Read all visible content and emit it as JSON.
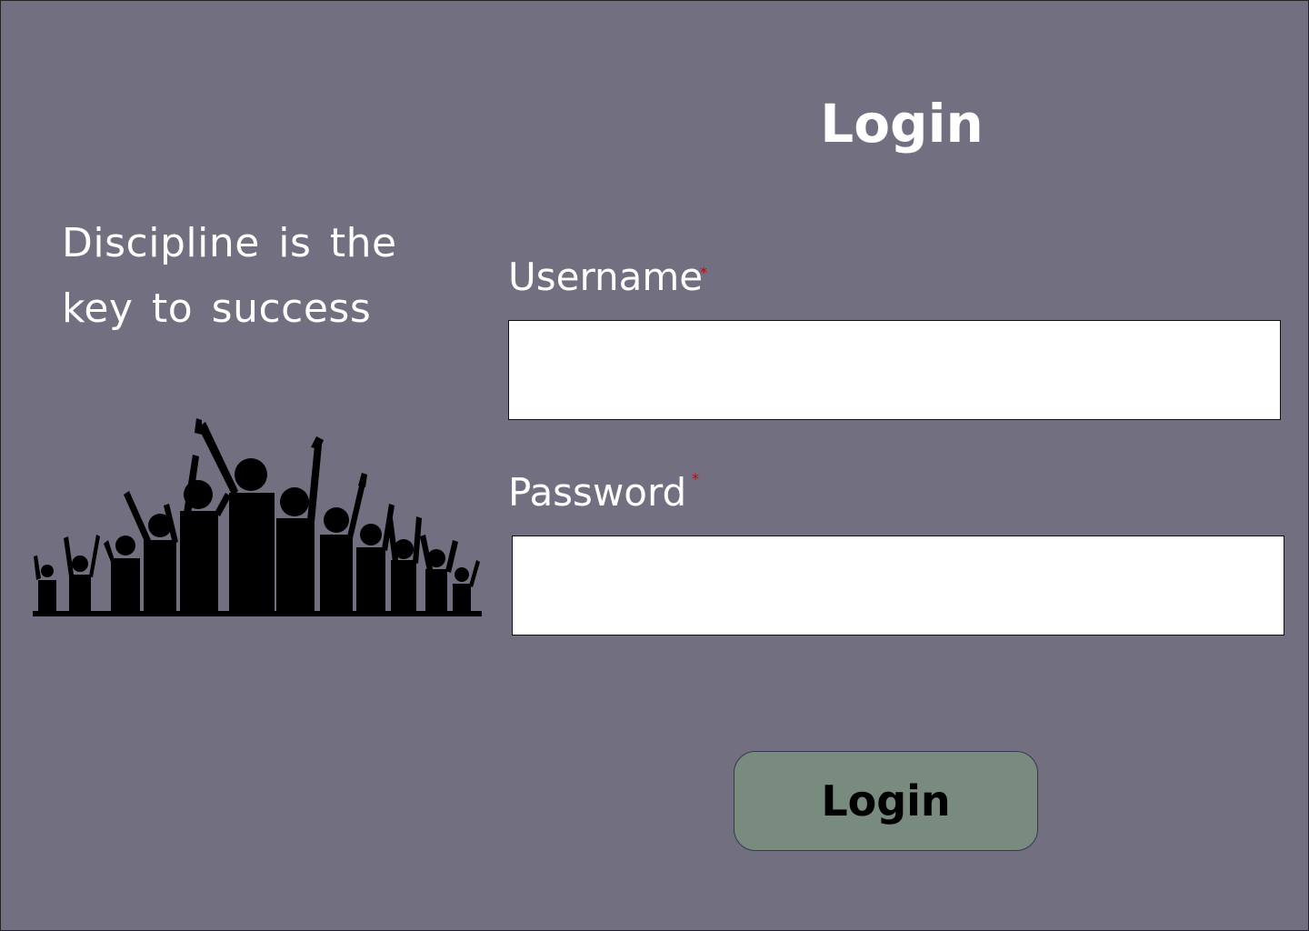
{
  "quote": {
    "line1": "Discipline is the",
    "line2": "key to success"
  },
  "illustration": {
    "icon": "cheering-crowd-silhouette-icon"
  },
  "login_form": {
    "title": "Login",
    "username": {
      "label": "Username",
      "required_mark": "*",
      "value": "",
      "placeholder": ""
    },
    "password": {
      "label": "Password",
      "required_mark": "*",
      "value": "",
      "placeholder": ""
    },
    "submit_label": "Login"
  },
  "colors": {
    "background": "#726f81",
    "button": "#798a7e",
    "required": "#cc0000",
    "text": "#ffffff"
  }
}
